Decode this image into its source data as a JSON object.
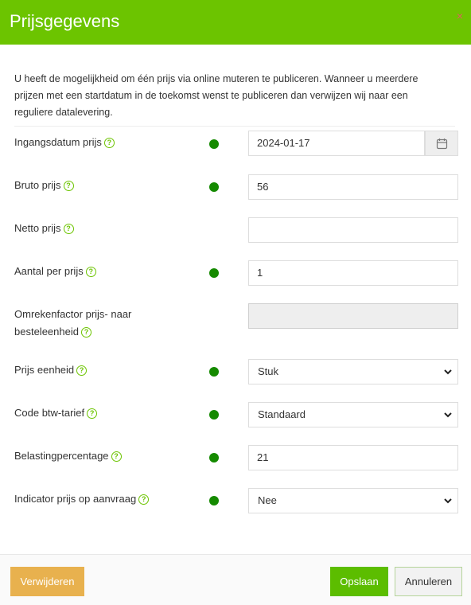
{
  "modal": {
    "title": "Prijsgegevens",
    "close": "×",
    "intro": "U heeft de mogelijkheid om één prijs via online muteren te publiceren. Wanneer u meerdere prijzen met een startdatum in de toekomst wenst te publiceren dan verwijzen wij naar een reguliere datalevering."
  },
  "fields": {
    "ingangsdatum": {
      "label": "Ingangsdatum prijs",
      "value": "2024-01-17"
    },
    "bruto": {
      "label": "Bruto prijs",
      "value": "56"
    },
    "netto": {
      "label": "Netto prijs",
      "value": ""
    },
    "aantal": {
      "label": "Aantal per prijs",
      "value": "1"
    },
    "omrekenfactor": {
      "label_line1": "Omrekenfactor prijs- naar",
      "label_line2": "besteleenheid",
      "value": ""
    },
    "eenheid": {
      "label": "Prijs eenheid",
      "value": "Stuk"
    },
    "btw": {
      "label": "Code btw-tarief",
      "value": "Standaard"
    },
    "belasting": {
      "label": "Belastingpercentage",
      "value": "21"
    },
    "aanvraag": {
      "label": "Indicator prijs op aanvraag",
      "value": "Nee"
    }
  },
  "help_glyph": "?",
  "footer": {
    "delete_label": "Verwijderen",
    "save_label": "Opslaan",
    "cancel_label": "Annuleren"
  },
  "colors": {
    "header": "#6cc400",
    "status_dot": "#158a00",
    "delete_button": "#e8b14e",
    "save_button": "#5cbd00"
  },
  "icons": [
    "close-icon",
    "help-icon",
    "calendar-icon",
    "chevron-down-icon"
  ]
}
